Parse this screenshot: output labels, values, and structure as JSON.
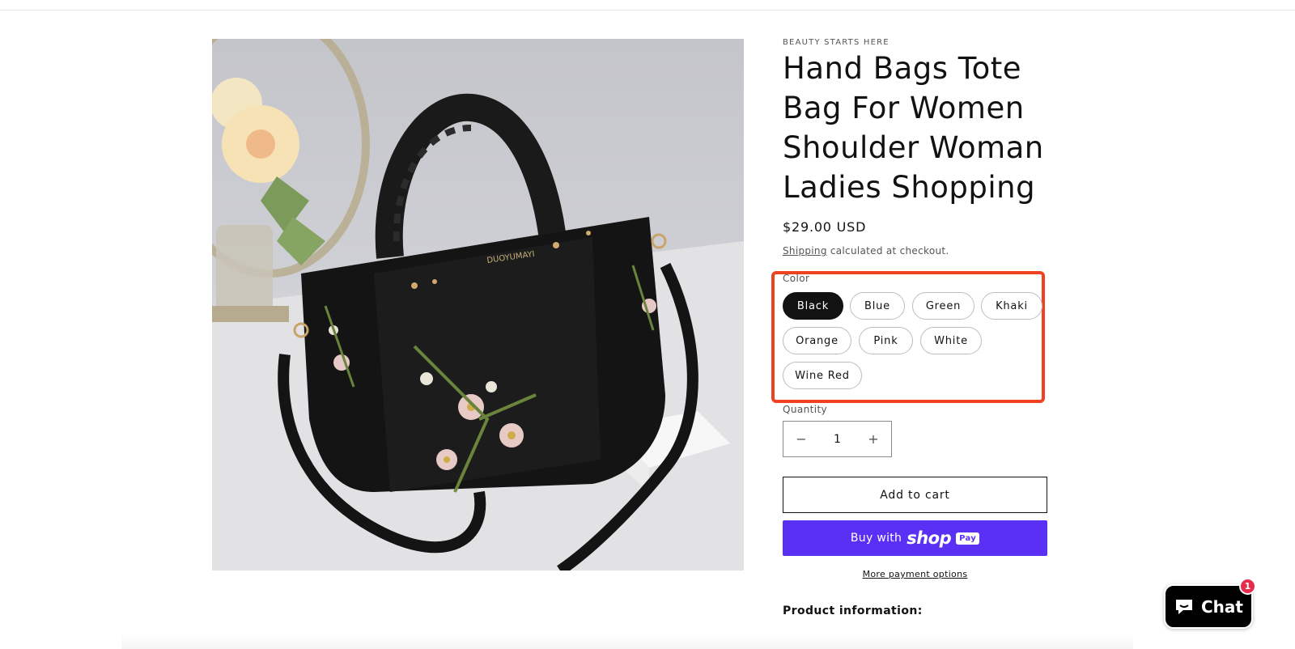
{
  "product": {
    "vendor": "BEAUTY STARTS HERE",
    "title": "Hand Bags Tote Bag For Women Shoulder Woman Ladies Shopping",
    "price": "$29.00 USD",
    "shipping_link": "Shipping",
    "shipping_note": " calculated at checkout.",
    "image_brand_text": "DUOYUMAYI"
  },
  "color": {
    "legend": "Color",
    "selected": "Black",
    "options": [
      "Black",
      "Blue",
      "Green",
      "Khaki",
      "Orange",
      "Pink",
      "White",
      "Wine Red"
    ]
  },
  "quantity": {
    "label": "Quantity",
    "value": "1",
    "minus_symbol": "−",
    "plus_symbol": "+"
  },
  "actions": {
    "add_to_cart": "Add to cart",
    "buy_with": "Buy with",
    "shop_word": "shop",
    "pay_badge": "Pay",
    "more_payment": "More payment options"
  },
  "section": {
    "product_information": "Product information:"
  },
  "chat": {
    "label": "Chat",
    "badge": "1"
  },
  "colors": {
    "highlight": "#ee4223",
    "shop_pay": "#5a31f4",
    "chat_badge": "#e72b4c",
    "selected_pill": "#121212"
  }
}
